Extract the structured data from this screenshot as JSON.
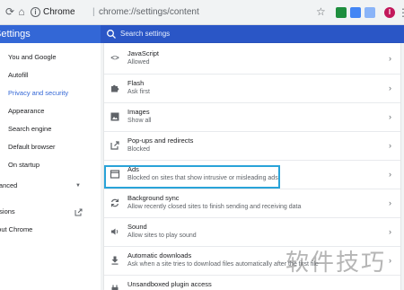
{
  "browser": {
    "site_label": "Chrome",
    "separator": "|",
    "url": "chrome://settings/content",
    "profile_initial": "I"
  },
  "header": {
    "title": "Settings",
    "search_placeholder": "Search settings"
  },
  "sidebar": {
    "items": [
      {
        "label": "You and Google"
      },
      {
        "label": "Autofill"
      },
      {
        "label": "Privacy and security"
      },
      {
        "label": "Appearance"
      },
      {
        "label": "Search engine"
      },
      {
        "label": "Default browser"
      },
      {
        "label": "On startup"
      },
      {
        "label": "Advanced"
      },
      {
        "label": "Extensions"
      },
      {
        "label": "About Chrome"
      }
    ]
  },
  "content_rows": [
    {
      "icon": "code-icon",
      "title": "JavaScript",
      "subtitle": "Allowed"
    },
    {
      "icon": "puzzle-icon",
      "title": "Flash",
      "subtitle": "Ask first"
    },
    {
      "icon": "image-icon",
      "title": "Images",
      "subtitle": "Show all"
    },
    {
      "icon": "open-in-new-icon",
      "title": "Pop-ups and redirects",
      "subtitle": "Blocked"
    },
    {
      "icon": "ads-icon",
      "title": "Ads",
      "subtitle": "Blocked on sites that show intrusive or misleading ads"
    },
    {
      "icon": "sync-icon",
      "title": "Background sync",
      "subtitle": "Allow recently closed sites to finish sending and receiving data"
    },
    {
      "icon": "volume-icon",
      "title": "Sound",
      "subtitle": "Allow sites to play sound"
    },
    {
      "icon": "download-icon",
      "title": "Automatic downloads",
      "subtitle": "Ask when a site tries to download files automatically after the first file"
    },
    {
      "icon": "plugin-icon",
      "title": "Unsandboxed plugin access",
      "subtitle": ""
    }
  ],
  "watermark": "软件技巧",
  "colors": {
    "header_blue": "#3367d6",
    "highlight_border": "#29a3d8",
    "active_nav": "#3367d6"
  }
}
